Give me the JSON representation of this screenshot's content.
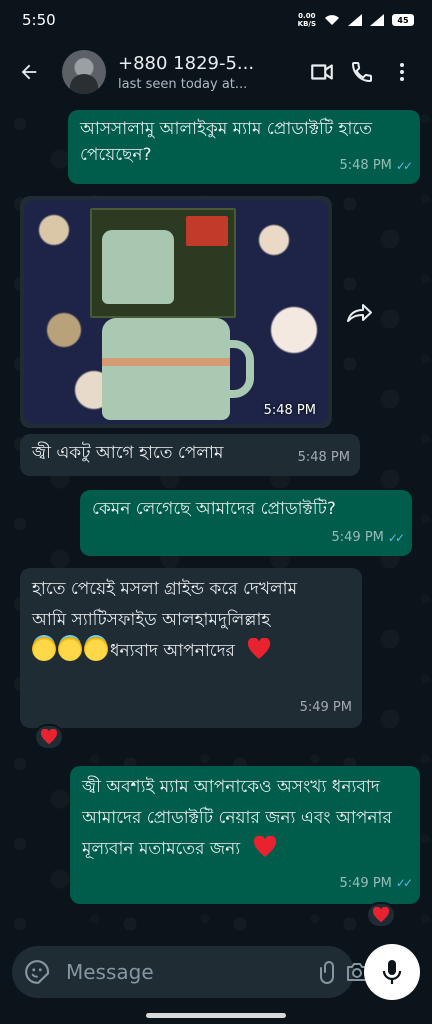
{
  "status_bar": {
    "time": "5:50",
    "net_speed_value": "0.00",
    "net_speed_unit": "KB/S",
    "battery": "45"
  },
  "header": {
    "contact_name": "+880 1829-5...",
    "last_seen": "last seen today at..."
  },
  "messages": [
    {
      "direction": "out",
      "text": "আসসালামু আলাইকুম ম্যাম প্রোডাক্টটি হাতে পেয়েছেন?",
      "time": "5:48 PM",
      "read": true
    },
    {
      "direction": "in",
      "type": "image",
      "time": "5:48 PM"
    },
    {
      "direction": "in",
      "text": "জ্বী একটু আগে হাতে পেলাম",
      "time": "5:48 PM"
    },
    {
      "direction": "out",
      "text": "কেমন লেগেছে আমাদের প্রোডাক্টটি?",
      "time": "5:49 PM",
      "read": true
    },
    {
      "direction": "in",
      "line1": "হাতে পেয়েই মসলা গ্রাইন্ড করে দেখলাম",
      "line2": "আমি স্যাটিসফাইড আলহামদুলিল্লাহ",
      "line3": "ধন্যবাদ আপনাদের",
      "time": "5:49 PM",
      "reaction": "heart"
    },
    {
      "direction": "out",
      "text": "জ্বী অবশ্যই ম্যাম আপনাকেও অসংখ্য ধন্যবাদ আমাদের প্রোডাক্টটি নেয়ার জন্য এবং আপনার মূল্যবান মতামতের জন্য",
      "time": "5:49 PM",
      "read": true,
      "reaction": "heart"
    }
  ],
  "composer": {
    "placeholder": "Message"
  },
  "icons": {
    "back": "arrow-left-icon",
    "video": "video-call-icon",
    "call": "phone-icon",
    "menu": "more-vertical-icon",
    "forward": "forward-icon",
    "sticker": "sticker-icon",
    "attach": "paperclip-icon",
    "camera": "camera-icon",
    "mic": "mic-icon",
    "heart": "red-heart-emoji"
  },
  "colors": {
    "background": "#0b141a",
    "outgoing_bubble": "#005c4b",
    "incoming_bubble": "#1f2c34",
    "read_ticks": "#53bdeb"
  }
}
